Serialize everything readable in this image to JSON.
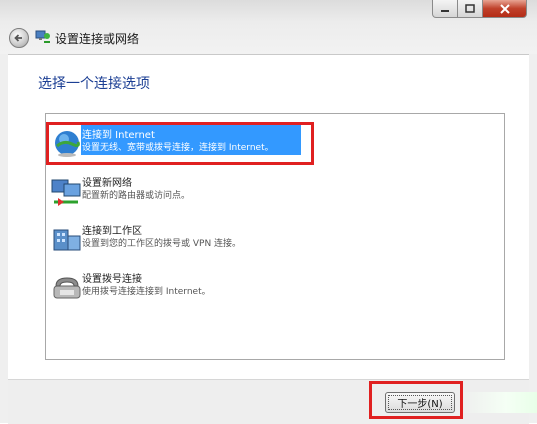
{
  "window": {
    "title": "设置连接或网络",
    "heading": "选择一个连接选项"
  },
  "options": [
    {
      "title": "连接到 Internet",
      "desc": "设置无线、宽带或拨号连接，连接到 Internet。",
      "icon": "globe-icon",
      "selected": true
    },
    {
      "title": "设置新网络",
      "desc": "配置新的路由器或访问点。",
      "icon": "network-icon",
      "selected": false
    },
    {
      "title": "连接到工作区",
      "desc": "设置到您的工作区的拨号或 VPN 连接。",
      "icon": "workplace-icon",
      "selected": false
    },
    {
      "title": "设置拨号连接",
      "desc": "使用拨号连接连接到 Internet。",
      "icon": "phone-modem-icon",
      "selected": false
    }
  ],
  "buttons": {
    "next": "下一步(N)"
  },
  "colors": {
    "heading": "#1c3f94",
    "selection": "#3399ff",
    "annotation": "#e02020",
    "close_button": "#c0412b"
  }
}
